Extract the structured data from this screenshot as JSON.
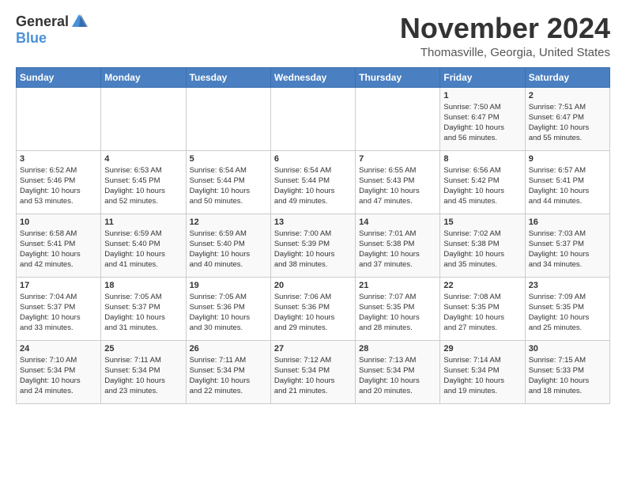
{
  "header": {
    "logo_general": "General",
    "logo_blue": "Blue",
    "month_title": "November 2024",
    "location": "Thomasville, Georgia, United States"
  },
  "weekdays": [
    "Sunday",
    "Monday",
    "Tuesday",
    "Wednesday",
    "Thursday",
    "Friday",
    "Saturday"
  ],
  "weeks": [
    [
      {
        "day": "",
        "info": ""
      },
      {
        "day": "",
        "info": ""
      },
      {
        "day": "",
        "info": ""
      },
      {
        "day": "",
        "info": ""
      },
      {
        "day": "",
        "info": ""
      },
      {
        "day": "1",
        "info": "Sunrise: 7:50 AM\nSunset: 6:47 PM\nDaylight: 10 hours\nand 56 minutes."
      },
      {
        "day": "2",
        "info": "Sunrise: 7:51 AM\nSunset: 6:47 PM\nDaylight: 10 hours\nand 55 minutes."
      }
    ],
    [
      {
        "day": "3",
        "info": "Sunrise: 6:52 AM\nSunset: 5:46 PM\nDaylight: 10 hours\nand 53 minutes."
      },
      {
        "day": "4",
        "info": "Sunrise: 6:53 AM\nSunset: 5:45 PM\nDaylight: 10 hours\nand 52 minutes."
      },
      {
        "day": "5",
        "info": "Sunrise: 6:54 AM\nSunset: 5:44 PM\nDaylight: 10 hours\nand 50 minutes."
      },
      {
        "day": "6",
        "info": "Sunrise: 6:54 AM\nSunset: 5:44 PM\nDaylight: 10 hours\nand 49 minutes."
      },
      {
        "day": "7",
        "info": "Sunrise: 6:55 AM\nSunset: 5:43 PM\nDaylight: 10 hours\nand 47 minutes."
      },
      {
        "day": "8",
        "info": "Sunrise: 6:56 AM\nSunset: 5:42 PM\nDaylight: 10 hours\nand 45 minutes."
      },
      {
        "day": "9",
        "info": "Sunrise: 6:57 AM\nSunset: 5:41 PM\nDaylight: 10 hours\nand 44 minutes."
      }
    ],
    [
      {
        "day": "10",
        "info": "Sunrise: 6:58 AM\nSunset: 5:41 PM\nDaylight: 10 hours\nand 42 minutes."
      },
      {
        "day": "11",
        "info": "Sunrise: 6:59 AM\nSunset: 5:40 PM\nDaylight: 10 hours\nand 41 minutes."
      },
      {
        "day": "12",
        "info": "Sunrise: 6:59 AM\nSunset: 5:40 PM\nDaylight: 10 hours\nand 40 minutes."
      },
      {
        "day": "13",
        "info": "Sunrise: 7:00 AM\nSunset: 5:39 PM\nDaylight: 10 hours\nand 38 minutes."
      },
      {
        "day": "14",
        "info": "Sunrise: 7:01 AM\nSunset: 5:38 PM\nDaylight: 10 hours\nand 37 minutes."
      },
      {
        "day": "15",
        "info": "Sunrise: 7:02 AM\nSunset: 5:38 PM\nDaylight: 10 hours\nand 35 minutes."
      },
      {
        "day": "16",
        "info": "Sunrise: 7:03 AM\nSunset: 5:37 PM\nDaylight: 10 hours\nand 34 minutes."
      }
    ],
    [
      {
        "day": "17",
        "info": "Sunrise: 7:04 AM\nSunset: 5:37 PM\nDaylight: 10 hours\nand 33 minutes."
      },
      {
        "day": "18",
        "info": "Sunrise: 7:05 AM\nSunset: 5:37 PM\nDaylight: 10 hours\nand 31 minutes."
      },
      {
        "day": "19",
        "info": "Sunrise: 7:05 AM\nSunset: 5:36 PM\nDaylight: 10 hours\nand 30 minutes."
      },
      {
        "day": "20",
        "info": "Sunrise: 7:06 AM\nSunset: 5:36 PM\nDaylight: 10 hours\nand 29 minutes."
      },
      {
        "day": "21",
        "info": "Sunrise: 7:07 AM\nSunset: 5:35 PM\nDaylight: 10 hours\nand 28 minutes."
      },
      {
        "day": "22",
        "info": "Sunrise: 7:08 AM\nSunset: 5:35 PM\nDaylight: 10 hours\nand 27 minutes."
      },
      {
        "day": "23",
        "info": "Sunrise: 7:09 AM\nSunset: 5:35 PM\nDaylight: 10 hours\nand 25 minutes."
      }
    ],
    [
      {
        "day": "24",
        "info": "Sunrise: 7:10 AM\nSunset: 5:34 PM\nDaylight: 10 hours\nand 24 minutes."
      },
      {
        "day": "25",
        "info": "Sunrise: 7:11 AM\nSunset: 5:34 PM\nDaylight: 10 hours\nand 23 minutes."
      },
      {
        "day": "26",
        "info": "Sunrise: 7:11 AM\nSunset: 5:34 PM\nDaylight: 10 hours\nand 22 minutes."
      },
      {
        "day": "27",
        "info": "Sunrise: 7:12 AM\nSunset: 5:34 PM\nDaylight: 10 hours\nand 21 minutes."
      },
      {
        "day": "28",
        "info": "Sunrise: 7:13 AM\nSunset: 5:34 PM\nDaylight: 10 hours\nand 20 minutes."
      },
      {
        "day": "29",
        "info": "Sunrise: 7:14 AM\nSunset: 5:34 PM\nDaylight: 10 hours\nand 19 minutes."
      },
      {
        "day": "30",
        "info": "Sunrise: 7:15 AM\nSunset: 5:33 PM\nDaylight: 10 hours\nand 18 minutes."
      }
    ]
  ]
}
